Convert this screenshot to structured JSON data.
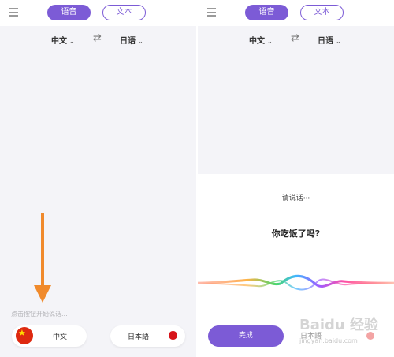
{
  "left": {
    "tabs": {
      "voice": "语音",
      "text": "文本"
    },
    "langs": {
      "source": "中文",
      "target": "日语",
      "chevron": "⌄",
      "swap": "⇄"
    },
    "hint": "点击按钮开始说话...",
    "buttons": {
      "chinese": "中文",
      "japanese": "日本語"
    }
  },
  "right": {
    "tabs": {
      "voice": "语音",
      "text": "文本"
    },
    "langs": {
      "source": "中文",
      "target": "日语",
      "chevron": "⌄",
      "swap": "⇄"
    },
    "sheet": {
      "prompt": "请说话···",
      "phrase": "你吃饭了吗?",
      "done": "完成",
      "japanese": "日本語"
    }
  },
  "watermark": {
    "main": "Baidu 经验",
    "sub": "jingyan.baidu.com"
  },
  "colors": {
    "accent": "#7c5bd6",
    "arrow": "#f08a2c",
    "cn_flag": "#de2910",
    "jp_dot": "#d7141a"
  },
  "icons": [
    "menu-icon",
    "swap-icon",
    "chevron-down-icon",
    "china-flag-icon",
    "japan-dot-icon",
    "arrow-down-icon",
    "voice-wave-icon"
  ]
}
